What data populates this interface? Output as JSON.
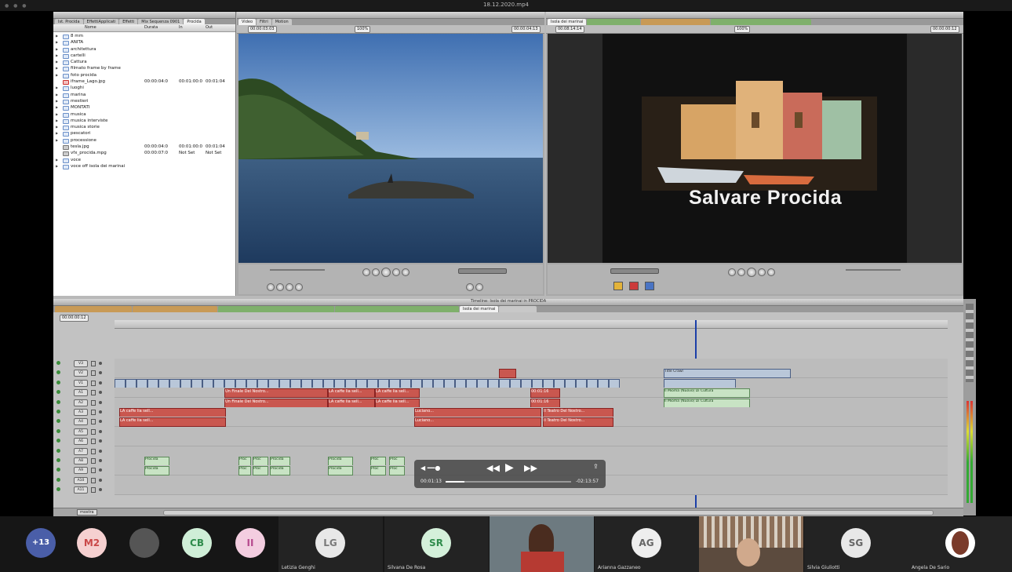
{
  "window": {
    "title": "18.12.2020.mp4"
  },
  "browser": {
    "tabs": [
      "Ist. Procida",
      "EffettiApplicati",
      "Effetti",
      "Mix Sequenza 0901",
      "Procida"
    ],
    "columns": {
      "name": "Nome",
      "duration": "Durata",
      "in": "In",
      "out": "Out"
    },
    "items": [
      {
        "name": "8 mm",
        "type": "folder",
        "duration": "",
        "in": "",
        "out": ""
      },
      {
        "name": "ANITA",
        "type": "folder",
        "duration": "",
        "in": "",
        "out": ""
      },
      {
        "name": "architettura",
        "type": "folder",
        "duration": "",
        "in": "",
        "out": ""
      },
      {
        "name": "cartelli",
        "type": "folder",
        "duration": "",
        "in": "",
        "out": ""
      },
      {
        "name": "Cattura",
        "type": "folder",
        "duration": "",
        "in": "",
        "out": ""
      },
      {
        "name": "filmato frame by frame",
        "type": "folder",
        "duration": "",
        "in": "",
        "out": ""
      },
      {
        "name": "foto procida",
        "type": "folder",
        "duration": "",
        "in": "",
        "out": ""
      },
      {
        "name": "iframe_Lago.jpg",
        "type": "image",
        "duration": "00:00:04:0",
        "in": "00:01:00:0",
        "out": "00:01:04"
      },
      {
        "name": "luoghi",
        "type": "folder",
        "duration": "",
        "in": "",
        "out": ""
      },
      {
        "name": "marina",
        "type": "folder",
        "duration": "",
        "in": "",
        "out": ""
      },
      {
        "name": "mestieri",
        "type": "folder",
        "duration": "",
        "in": "",
        "out": ""
      },
      {
        "name": "MONTATI",
        "type": "folder",
        "duration": "",
        "in": "",
        "out": ""
      },
      {
        "name": "musica",
        "type": "folder",
        "duration": "",
        "in": "",
        "out": ""
      },
      {
        "name": "musica interviste",
        "type": "folder",
        "duration": "",
        "in": "",
        "out": ""
      },
      {
        "name": "musica storie",
        "type": "folder",
        "duration": "",
        "in": "",
        "out": ""
      },
      {
        "name": "pescatori",
        "type": "folder",
        "duration": "",
        "in": "",
        "out": ""
      },
      {
        "name": "processione",
        "type": "folder",
        "duration": "",
        "in": "",
        "out": ""
      },
      {
        "name": "tesla.jpg",
        "type": "clip",
        "duration": "00:00:04:0",
        "in": "00:01:00:0",
        "out": "00:01:04"
      },
      {
        "name": "vfx_procida.mpg",
        "type": "clip",
        "duration": "00:00:07:0",
        "in": "Not Set",
        "out": "Not Set"
      },
      {
        "name": "voce",
        "type": "folder",
        "duration": "",
        "in": "",
        "out": ""
      },
      {
        "name": "voce off isola dei marinai",
        "type": "folder",
        "duration": "",
        "in": "",
        "out": ""
      }
    ]
  },
  "viewer": {
    "tabs": [
      "Video",
      "Filtri",
      "Motion"
    ],
    "tc_left": "00:00:03:03",
    "tc_right": "00:00:04:13",
    "zoom": "100%"
  },
  "canvas": {
    "tabs": [
      "Isola dei marinai"
    ],
    "tc_left": "00:08:14:14",
    "tc_right": "00:00:00:12",
    "title_text": "Salvare Procida",
    "zoom": "100%"
  },
  "timeline": {
    "title": "Timeline: Isola dei marinai in PROCIDA",
    "timecode": "00:00:00:12",
    "sequence_tabs": [
      "Isola dei marinai"
    ],
    "title_clip": "Title Crawl",
    "audio_tracks": [
      "A1",
      "A2",
      "A3",
      "A4",
      "A5",
      "A6",
      "A7",
      "A8",
      "A9",
      "A10",
      "A11"
    ],
    "video_tracks": [
      "V3",
      "V2",
      "V1"
    ],
    "clip_labels": {
      "procida": "Procida",
      "proc": "Proc",
      "la_caffe": "LA caffe lia sell...",
      "un_finale": "Un Finale Del Nostro...",
      "luciano": "Luciano...",
      "il_teatro": "Il Teatro Del Nostro...",
      "tempo": "00:01:16",
      "il_mioma": "Il Mioma (Nuovo) Di Cultura"
    },
    "zoom_label": "mostra"
  },
  "player_overlay": {
    "current": "00:01:13",
    "remaining": "-02:13:57"
  },
  "participants": {
    "more": "+13",
    "items": [
      {
        "initials": "M2",
        "color": "#e56c6c",
        "name": ""
      },
      {
        "initials": "CB",
        "color": "#4fba72",
        "name": ""
      },
      {
        "initials": "II",
        "color": "#b64a8e",
        "name": ""
      },
      {
        "initials": "LG",
        "color": "#9a9a9a",
        "name": "Letizia Genghi"
      },
      {
        "initials": "SR",
        "color": "#49a85c",
        "name": "Silvana De Rosa"
      },
      {
        "initials": "AG",
        "color": "#b0b0b0",
        "name": "Arianna Gazzaneo"
      },
      {
        "initials": "SG",
        "color": "#8b8b8b",
        "name": "Silvia Giuliotti"
      },
      {
        "initials": "",
        "color": "#ffffff",
        "name": "Angela De Sario"
      }
    ]
  }
}
